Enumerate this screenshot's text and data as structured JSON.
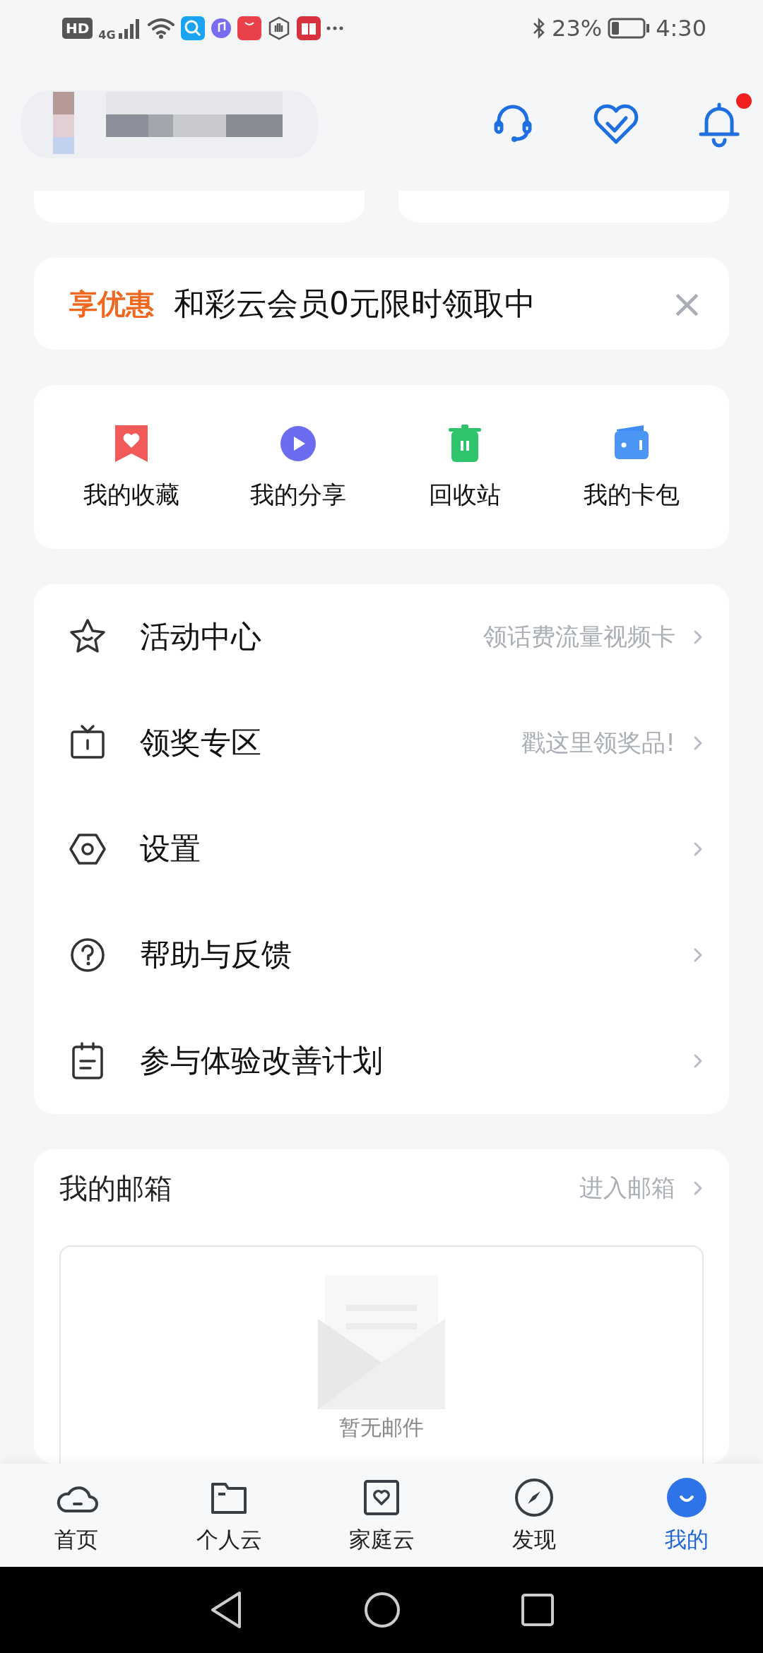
{
  "status_bar": {
    "network": "HD",
    "signal_label": "4G",
    "battery": "23%",
    "time": "4:30"
  },
  "header": {
    "notification_dot": true
  },
  "promo": {
    "tag": "享优惠",
    "text": "和彩云会员0元限时领取中",
    "close": "×"
  },
  "quick_actions": [
    {
      "label": "我的收藏"
    },
    {
      "label": "我的分享"
    },
    {
      "label": "回收站"
    },
    {
      "label": "我的卡包"
    }
  ],
  "menu": [
    {
      "label": "活动中心",
      "hint": "领话费流量视频卡"
    },
    {
      "label": "领奖专区",
      "hint": "戳这里领奖品!"
    },
    {
      "label": "设置"
    },
    {
      "label": "帮助与反馈"
    },
    {
      "label": "参与体验改善计划"
    }
  ],
  "mailbox": {
    "title": "我的邮箱",
    "link": "进入邮箱",
    "empty_text": "暂无邮件"
  },
  "bottom_nav": [
    {
      "label": "首页",
      "selected": false
    },
    {
      "label": "个人云",
      "selected": false
    },
    {
      "label": "家庭云",
      "selected": false
    },
    {
      "label": "发现",
      "selected": false
    },
    {
      "label": "我的",
      "selected": true
    }
  ]
}
